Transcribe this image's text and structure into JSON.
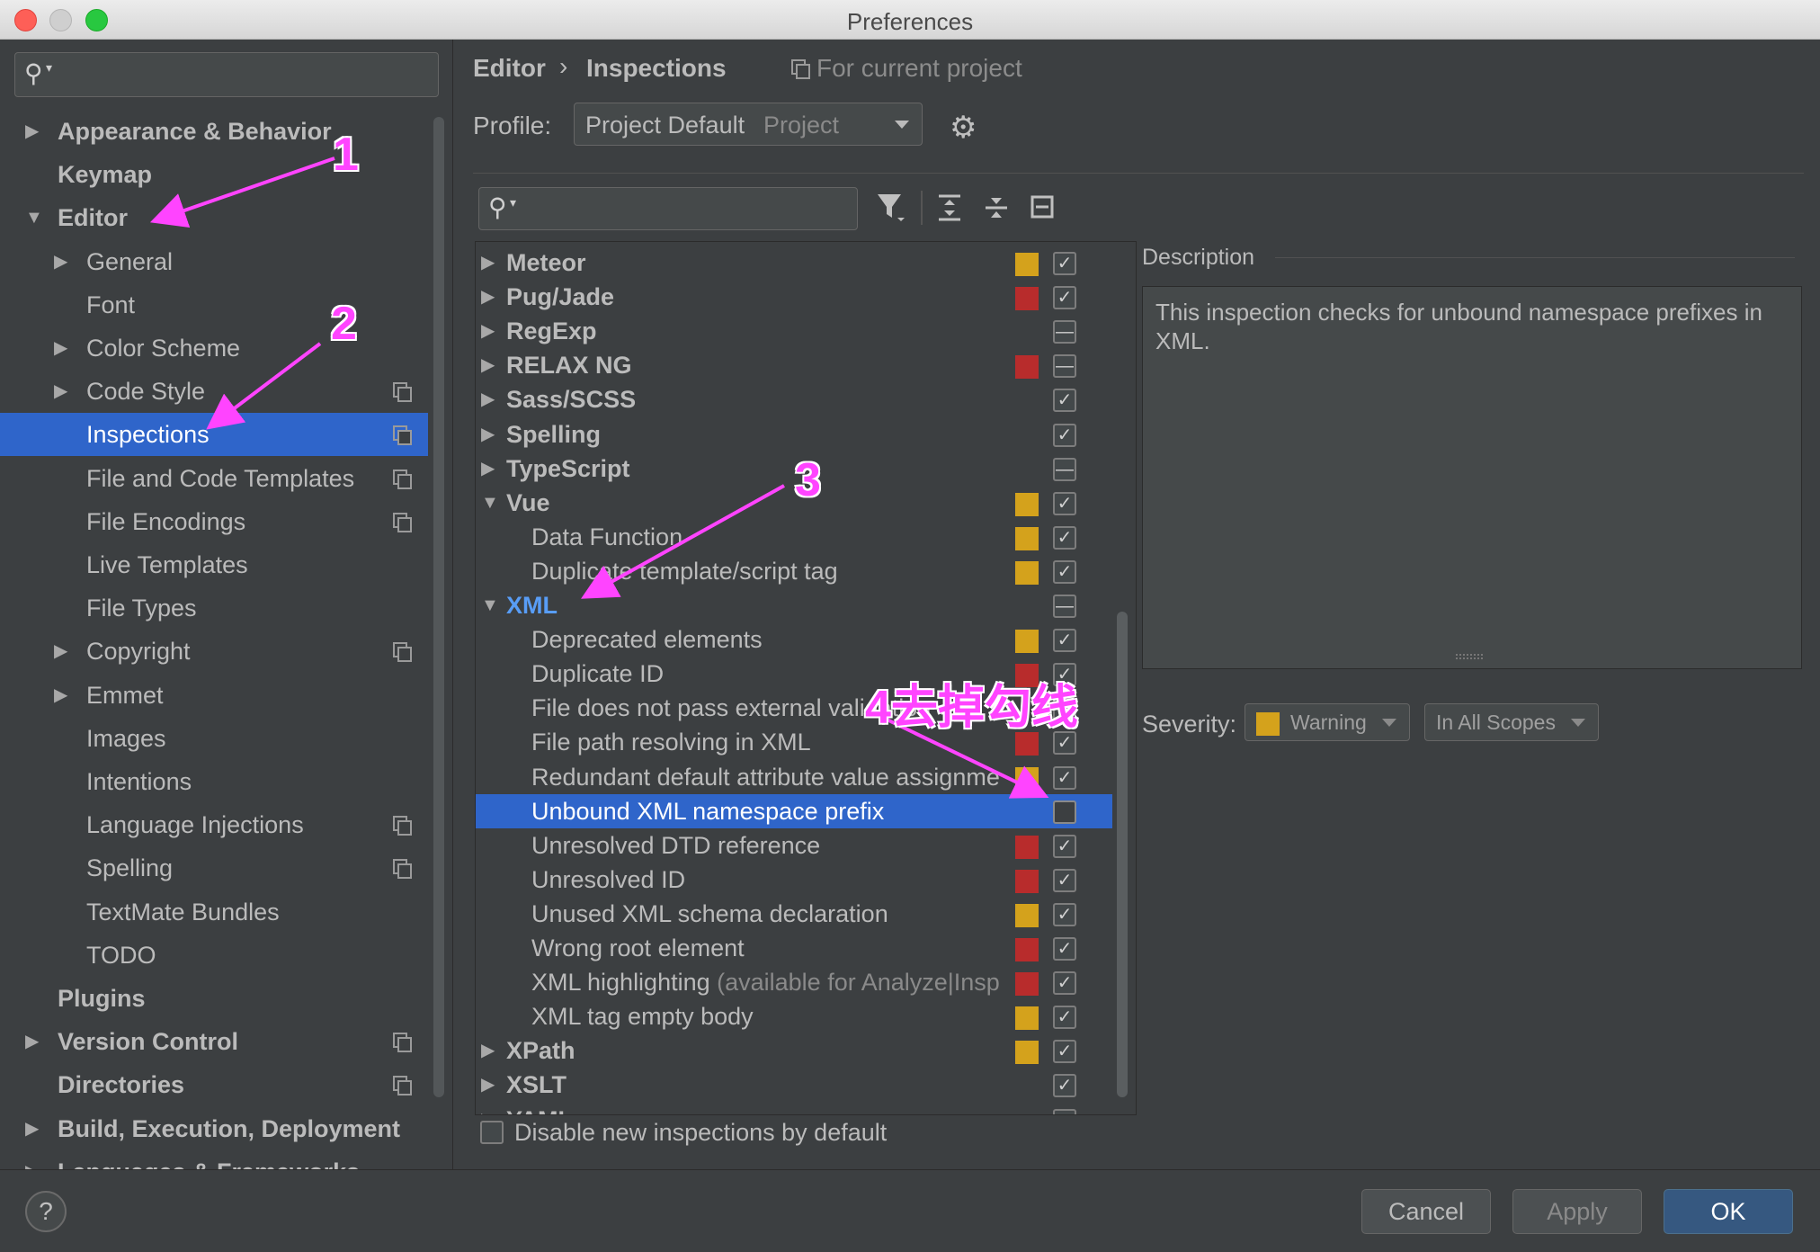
{
  "window": {
    "title": "Preferences"
  },
  "left_search": {
    "placeholder": ""
  },
  "sidebar": {
    "items": [
      {
        "label": "Appearance & Behavior",
        "level": 0,
        "arrow": "▶",
        "bold": true,
        "copy": false
      },
      {
        "label": "Keymap",
        "level": 0,
        "arrow": "",
        "bold": true,
        "copy": false
      },
      {
        "label": "Editor",
        "level": 0,
        "arrow": "▼",
        "bold": true,
        "copy": false
      },
      {
        "label": "General",
        "level": 1,
        "arrow": "▶",
        "bold": false,
        "copy": false
      },
      {
        "label": "Font",
        "level": 1,
        "arrow": "",
        "bold": false,
        "copy": false
      },
      {
        "label": "Color Scheme",
        "level": 1,
        "arrow": "▶",
        "bold": false,
        "copy": false
      },
      {
        "label": "Code Style",
        "level": 1,
        "arrow": "▶",
        "bold": false,
        "copy": true
      },
      {
        "label": "Inspections",
        "level": 1,
        "arrow": "",
        "bold": false,
        "copy": true,
        "selected": true
      },
      {
        "label": "File and Code Templates",
        "level": 1,
        "arrow": "",
        "bold": false,
        "copy": true
      },
      {
        "label": "File Encodings",
        "level": 1,
        "arrow": "",
        "bold": false,
        "copy": true
      },
      {
        "label": "Live Templates",
        "level": 1,
        "arrow": "",
        "bold": false,
        "copy": false
      },
      {
        "label": "File Types",
        "level": 1,
        "arrow": "",
        "bold": false,
        "copy": false
      },
      {
        "label": "Copyright",
        "level": 1,
        "arrow": "▶",
        "bold": false,
        "copy": true
      },
      {
        "label": "Emmet",
        "level": 1,
        "arrow": "▶",
        "bold": false,
        "copy": false
      },
      {
        "label": "Images",
        "level": 1,
        "arrow": "",
        "bold": false,
        "copy": false
      },
      {
        "label": "Intentions",
        "level": 1,
        "arrow": "",
        "bold": false,
        "copy": false
      },
      {
        "label": "Language Injections",
        "level": 1,
        "arrow": "",
        "bold": false,
        "copy": true
      },
      {
        "label": "Spelling",
        "level": 1,
        "arrow": "",
        "bold": false,
        "copy": true
      },
      {
        "label": "TextMate Bundles",
        "level": 1,
        "arrow": "",
        "bold": false,
        "copy": false
      },
      {
        "label": "TODO",
        "level": 1,
        "arrow": "",
        "bold": false,
        "copy": false
      },
      {
        "label": "Plugins",
        "level": 0,
        "arrow": "",
        "bold": true,
        "copy": false
      },
      {
        "label": "Version Control",
        "level": 0,
        "arrow": "▶",
        "bold": true,
        "copy": true
      },
      {
        "label": "Directories",
        "level": 0,
        "arrow": "",
        "bold": true,
        "copy": true
      },
      {
        "label": "Build, Execution, Deployment",
        "level": 0,
        "arrow": "▶",
        "bold": true,
        "copy": false
      },
      {
        "label": "Languages & Frameworks",
        "level": 0,
        "arrow": "▶",
        "bold": true,
        "copy": false
      }
    ]
  },
  "header": {
    "breadcrumb_1": "Editor",
    "breadcrumb_sep": "›",
    "breadcrumb_2": "Inspections",
    "scope_note": "For current project",
    "profile_label": "Profile:",
    "profile_value": "Project Default",
    "profile_suffix": "Project"
  },
  "inspections": {
    "search_placeholder": "",
    "rows": [
      {
        "label": "Meteor",
        "group": true,
        "expanded": false,
        "severity": "#d4a21c",
        "state": "checked"
      },
      {
        "label": "Pug/Jade",
        "group": true,
        "expanded": false,
        "severity": "#b82c2c",
        "state": "checked"
      },
      {
        "label": "RegExp",
        "group": true,
        "expanded": false,
        "severity": "",
        "state": "partial"
      },
      {
        "label": "RELAX NG",
        "group": true,
        "expanded": false,
        "severity": "#b82c2c",
        "state": "partial"
      },
      {
        "label": "Sass/SCSS",
        "group": true,
        "expanded": false,
        "severity": "",
        "state": "checked"
      },
      {
        "label": "Spelling",
        "group": true,
        "expanded": false,
        "severity": "",
        "state": "checked"
      },
      {
        "label": "TypeScript",
        "group": true,
        "expanded": false,
        "severity": "",
        "state": "partial"
      },
      {
        "label": "Vue",
        "group": true,
        "expanded": true,
        "severity": "#d4a21c",
        "state": "checked"
      },
      {
        "label": "Data Function",
        "group": false,
        "severity": "#d4a21c",
        "state": "checked"
      },
      {
        "label": "Duplicate template/script tag",
        "group": false,
        "severity": "#d4a21c",
        "state": "checked"
      },
      {
        "label": "XML",
        "group": true,
        "expanded": true,
        "severity": "",
        "state": "partial",
        "highlight": true
      },
      {
        "label": "Deprecated elements",
        "group": false,
        "severity": "#d4a21c",
        "state": "checked"
      },
      {
        "label": "Duplicate ID",
        "group": false,
        "severity": "#b82c2c",
        "state": "checked"
      },
      {
        "label": "File does not pass external validation",
        "group": false,
        "severity": "",
        "state": "checked"
      },
      {
        "label": "File path resolving in XML",
        "group": false,
        "severity": "#b82c2c",
        "state": "checked"
      },
      {
        "label": "Redundant default attribute value assignment",
        "group": false,
        "severity": "#d4a21c",
        "state": "checked"
      },
      {
        "label": "Unbound XML namespace prefix",
        "group": false,
        "severity": "",
        "state": "unchecked",
        "selected": true
      },
      {
        "label": "Unresolved DTD reference",
        "group": false,
        "severity": "#b82c2c",
        "state": "checked"
      },
      {
        "label": "Unresolved ID",
        "group": false,
        "severity": "#b82c2c",
        "state": "checked"
      },
      {
        "label": "Unused XML schema declaration",
        "group": false,
        "severity": "#d4a21c",
        "state": "checked"
      },
      {
        "label": "Wrong root element",
        "group": false,
        "severity": "#b82c2c",
        "state": "checked"
      },
      {
        "label": "XML highlighting",
        "suffix": " (available for Analyze|Inspect Code)",
        "group": false,
        "severity": "#b82c2c",
        "state": "checked"
      },
      {
        "label": "XML tag empty body",
        "group": false,
        "severity": "#d4a21c",
        "state": "checked"
      },
      {
        "label": "XPath",
        "group": true,
        "expanded": false,
        "severity": "#d4a21c",
        "state": "checked"
      },
      {
        "label": "XSLT",
        "group": true,
        "expanded": false,
        "severity": "",
        "state": "checked"
      },
      {
        "label": "YAML",
        "group": true,
        "expanded": false,
        "severity": "",
        "state": "checked"
      }
    ],
    "disable_new_label": "Disable new inspections by default"
  },
  "description": {
    "title": "Description",
    "text": "This inspection checks for unbound namespace prefixes in XML.",
    "severity_label": "Severity:",
    "severity_value": "Warning",
    "severity_color": "#d4a21c",
    "scope_value": "In All Scopes"
  },
  "footer": {
    "help": "?",
    "cancel": "Cancel",
    "apply": "Apply",
    "ok": "OK"
  },
  "annotations": {
    "a1": "1",
    "a2": "2",
    "a3": "3",
    "a4": "4去掉勾线",
    "color": "#ff44ff"
  }
}
